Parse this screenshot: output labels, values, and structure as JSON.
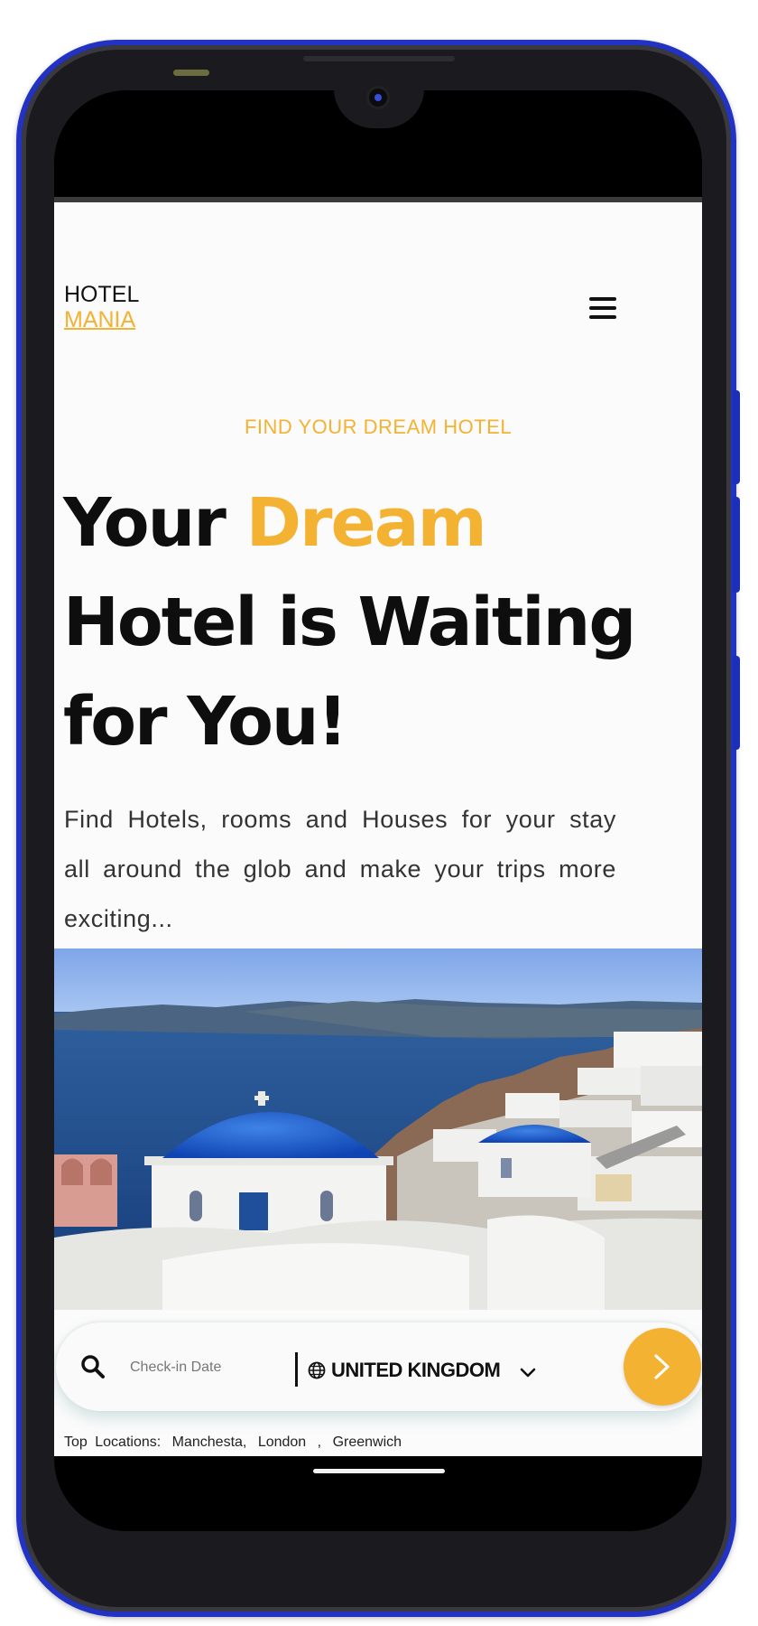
{
  "brand": {
    "line1": "HOTEL",
    "line2": "MANIA"
  },
  "nav": {
    "menu_icon": "hamburger-menu-icon"
  },
  "hero": {
    "eyebrow": "FIND YOUR DREAM HOTEL",
    "headline_part1": "Your ",
    "headline_accent": "Dream",
    "headline_part2": " Hotel is Waiting for You!",
    "description": "Find Hotels, rooms and Houses for your stay all around the glob and make your trips more exciting..."
  },
  "search": {
    "search_icon": "search-icon",
    "checkin_placeholder": "Check-in Date",
    "globe_icon": "globe-icon",
    "country": "UNITED KINGDOM",
    "chevron_icon": "chevron-down-icon",
    "go_icon": "chevron-right-icon"
  },
  "top_locations": {
    "label": "Top Locations:",
    "items": [
      "Manchesta,",
      "London",
      ",",
      "Greenwich"
    ]
  },
  "colors": {
    "accent": "#f4b232",
    "text": "#0e0e0e",
    "frame": "#2233c4"
  }
}
